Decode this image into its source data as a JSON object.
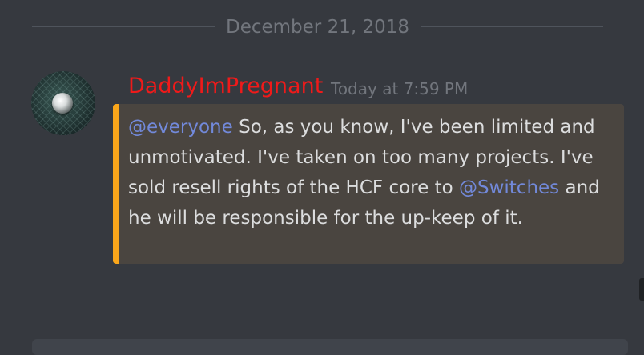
{
  "divider": {
    "date": "December 21, 2018"
  },
  "message": {
    "author": "DaddyImPregnant",
    "author_color": "#f01a1a",
    "timestamp": "Today at 7:59 PM",
    "accent_color": "#faa61a",
    "mention_everyone": "@everyone",
    "text_part1": " So, as you know, I've been limited and unmotivated. I've taken on too many projects. I've sold resell rights of the HCF core to ",
    "mention_user": "@Switches",
    "text_part2": " and he will be responsible for the up-keep of it."
  },
  "colors": {
    "background": "#36393f",
    "mention": "#7289da",
    "text": "#dcddde",
    "muted": "#72767d"
  }
}
